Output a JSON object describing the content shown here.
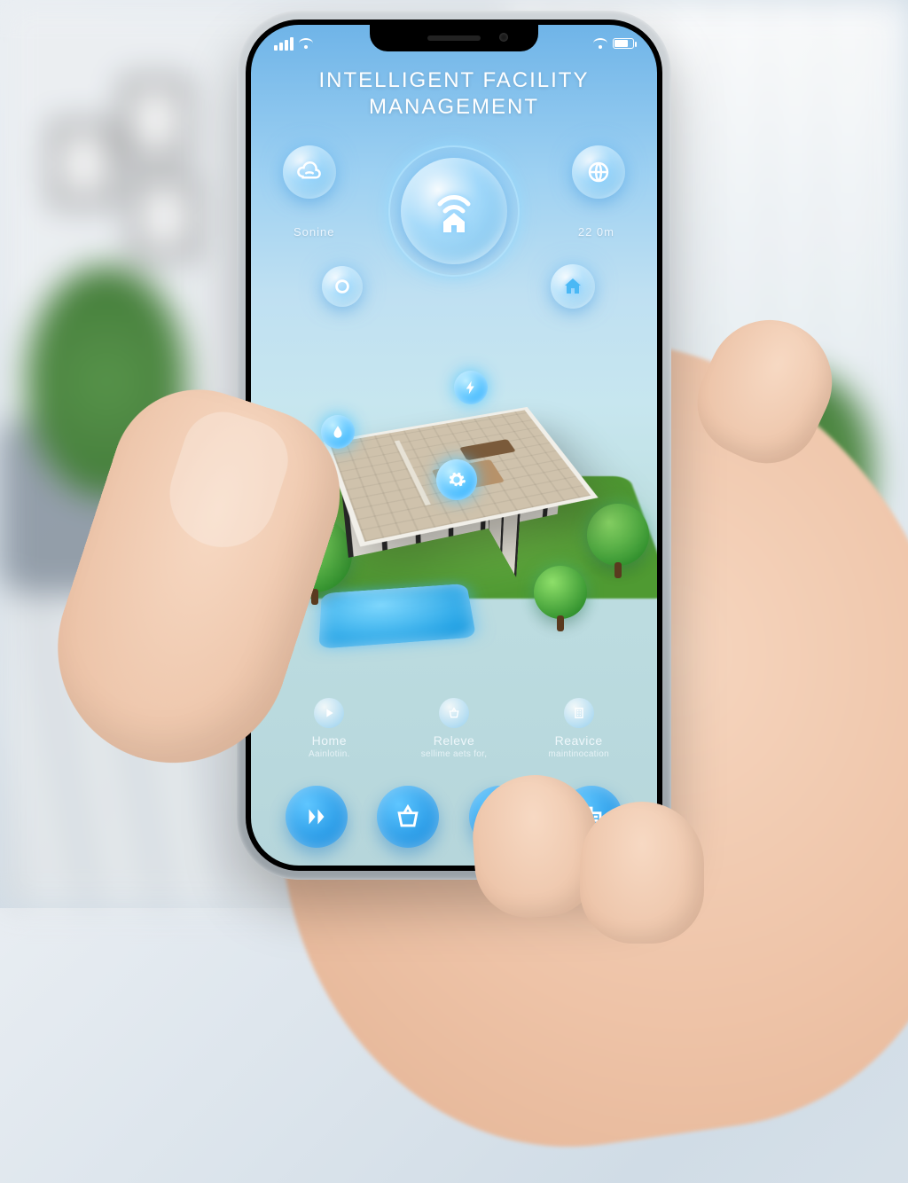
{
  "app": {
    "title_line1": "INTELLIGENT FACILITY",
    "title_line2": "MANAGEMENT"
  },
  "hero": {
    "left_label": "Sonine",
    "right_label": "22 0m",
    "main_icon": "wifi-home-icon",
    "orb_top_left_icon": "wifi-cloud-icon",
    "orb_top_right_icon": "globe-icon",
    "orb_mid_left_icon": "ring-icon",
    "orb_mid_right_icon": "home-outline-icon"
  },
  "hotspots": [
    {
      "icon": "drop-icon"
    },
    {
      "icon": "bolt-icon"
    },
    {
      "icon": "gear-icon"
    }
  ],
  "categories": [
    {
      "title": "Home",
      "subtitle": "Aainlotiin.",
      "icon": "play-icon"
    },
    {
      "title": "Releve",
      "subtitle": "sellime aets for,",
      "icon": "basket-icon"
    },
    {
      "title": "Reavice",
      "subtitle": "maintinocation",
      "icon": "building-icon"
    }
  ],
  "nav": [
    {
      "name": "nav-play",
      "icon": "skip-play-icon"
    },
    {
      "name": "nav-basket",
      "icon": "basket-icon"
    },
    {
      "name": "nav-pointer",
      "icon": "pointer-icon"
    },
    {
      "name": "nav-building",
      "icon": "building-icon"
    }
  ],
  "colors": {
    "accent": "#2aa4ef",
    "glow": "#8fdcff",
    "lawn": "#5aad3a",
    "pool": "#2aa8e8"
  }
}
